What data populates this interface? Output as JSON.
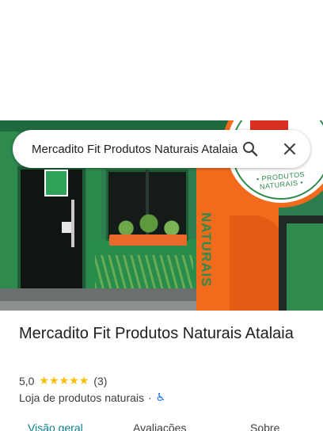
{
  "search": {
    "query": "Mercadito Fit Produtos Naturais Atalaia",
    "search_icon": "search-icon",
    "close_icon": "close-icon"
  },
  "photo": {
    "sign_text": "• PRODUTOS NATURAIS •",
    "vertical_word": "NATURAIS"
  },
  "place": {
    "title": "Mercadito Fit Produtos Naturais Atalaia",
    "rating": "5,0",
    "stars": [
      "★",
      "★",
      "★",
      "★",
      "★"
    ],
    "review_count": "(3)",
    "category": "Loja de produtos naturais",
    "separator": "·",
    "accessibility_icon": "♿"
  },
  "tabs": [
    {
      "label": "Visão geral",
      "active": true
    },
    {
      "label": "Avaliações",
      "active": false
    },
    {
      "label": "Sobre",
      "active": false
    }
  ],
  "colors": {
    "star": "#fbbc04",
    "active_tab": "#0b7f8f",
    "accessibility": "#1a73e8"
  }
}
